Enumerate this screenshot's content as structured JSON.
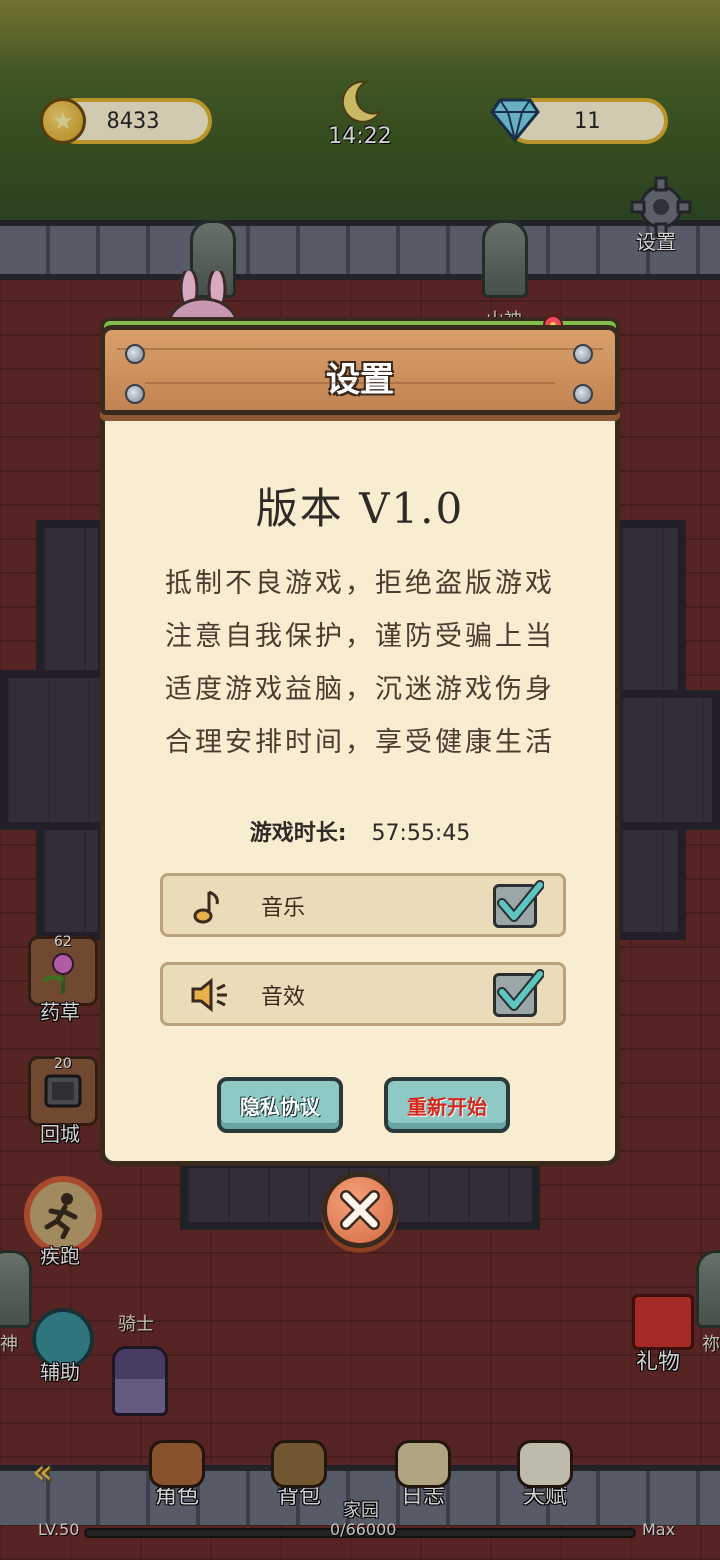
{
  "hud": {
    "coins": "8433",
    "time": "14:22",
    "gems": "11",
    "settings_label": "设置"
  },
  "scene_labels": {
    "statue_mountain_god": "山神",
    "statue_left_partial": "神",
    "statue_right_partial": "祢",
    "knight": "骑士"
  },
  "side_menu": {
    "herbs": {
      "count": "62",
      "label": "药草"
    },
    "return_city": {
      "count": "20",
      "label": "回城"
    },
    "sprint": {
      "label": "疾跑"
    },
    "assist": {
      "label": "辅助"
    },
    "gift": {
      "label": "礼物"
    }
  },
  "bottom_nav": {
    "items": [
      {
        "label": "角色"
      },
      {
        "label": "背包"
      },
      {
        "label": "家园"
      },
      {
        "label": "日志"
      },
      {
        "label": "天赋"
      }
    ],
    "level": "LV.50",
    "xp": "0/66000",
    "max": "Max"
  },
  "dialog": {
    "title": "设置",
    "version": "版本 V1.0",
    "notice": [
      "抵制不良游戏，拒绝盗版游戏",
      "注意自我保护，谨防受骗上当",
      "适度游戏益脑，沉迷游戏伤身",
      "合理安排时间，享受健康生活"
    ],
    "playtime_label": "游戏时长:",
    "playtime_value": "57:55:45",
    "music": {
      "label": "音乐",
      "checked": true
    },
    "sound": {
      "label": "音效",
      "checked": true
    },
    "privacy_button": "隐私协议",
    "restart_button": "重新开始"
  },
  "colors": {
    "dialog_bg": "#f8ecd1",
    "header_wood": "#c28452",
    "button_teal": "#8fc9c6",
    "restart_text": "#d22a1e",
    "check_teal": "#5ec6c0"
  },
  "icons": [
    "coin-icon",
    "moon-icon",
    "gem-icon",
    "gear-icon",
    "music-note-icon",
    "speaker-icon",
    "check-icon",
    "close-icon"
  ]
}
